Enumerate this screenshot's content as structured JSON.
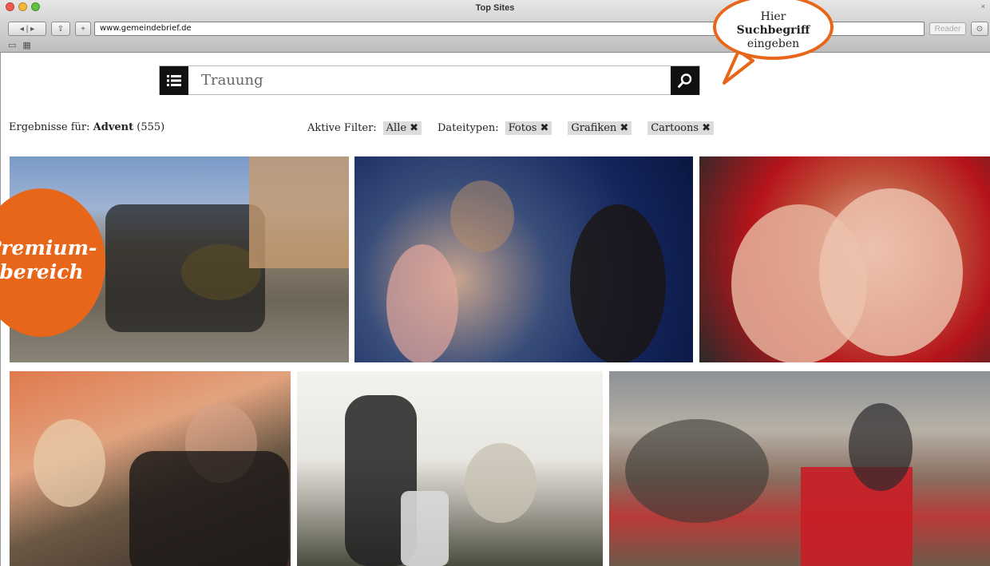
{
  "window": {
    "title": "Top Sites",
    "address": "www.gemeindebrief.de",
    "reader_label": "Reader",
    "close_glyph": "×"
  },
  "callout": {
    "line1": "Hier",
    "line2": "Suchbegriff",
    "line3": "eingeben",
    "color": "#e8661a"
  },
  "search": {
    "query": "Trauung",
    "menu_icon": "list-icon",
    "search_icon": "magnifier-icon"
  },
  "results": {
    "prefix": "Ergebnisse für:",
    "term": "Advent",
    "count": "(555)"
  },
  "filters": {
    "active_label": "Aktive Filter:",
    "active": [
      "Alle"
    ],
    "types_label": "Dateitypen:",
    "types": [
      "Fotos",
      "Grafiken",
      "Cartoons"
    ],
    "remove_glyph": "✖"
  },
  "badge": {
    "line1": "Premium-",
    "line2": "bereich",
    "color": "#e8661a"
  }
}
